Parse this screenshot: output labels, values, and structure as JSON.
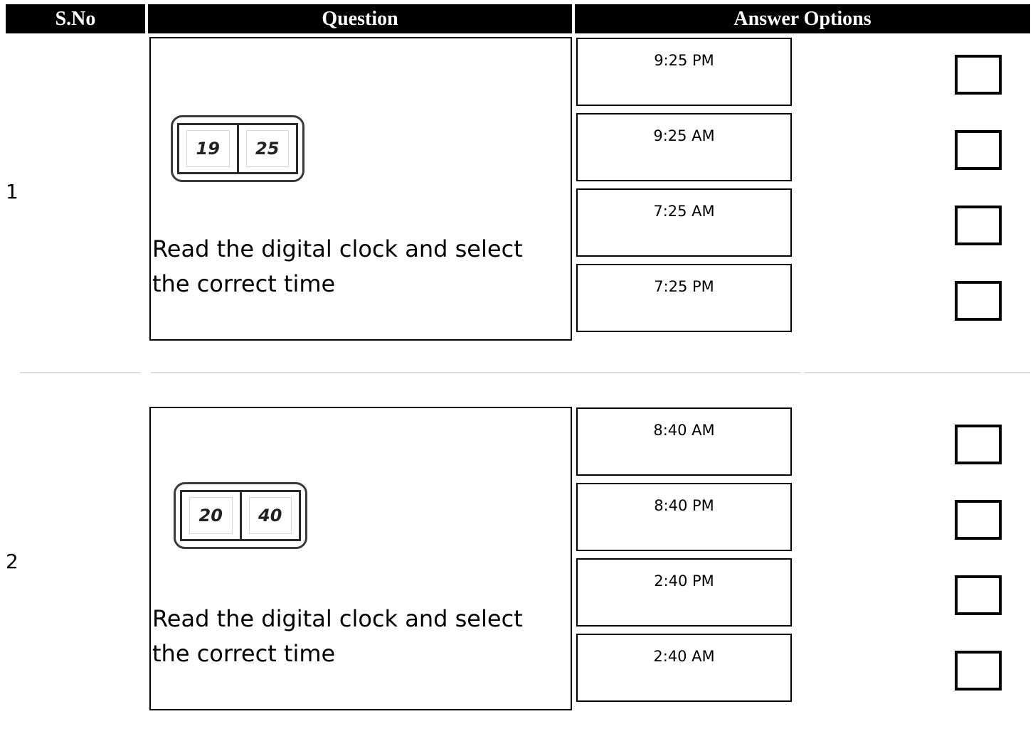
{
  "header": {
    "sno": "S.No",
    "question": "Question",
    "answers": "Answer Options"
  },
  "rows": [
    {
      "sno": "1",
      "clock": {
        "hours": "19",
        "minutes": "25"
      },
      "question": "Read the digital clock and select the correct time",
      "options": [
        "9:25 PM",
        "9:25 AM",
        "7:25 AM",
        "7:25 PM"
      ]
    },
    {
      "sno": "2",
      "clock": {
        "hours": "20",
        "minutes": "40"
      },
      "question": "Read the digital clock and select the correct time",
      "options": [
        "8:40 AM",
        "8:40 PM",
        "2:40 PM",
        "2:40 AM"
      ]
    }
  ]
}
